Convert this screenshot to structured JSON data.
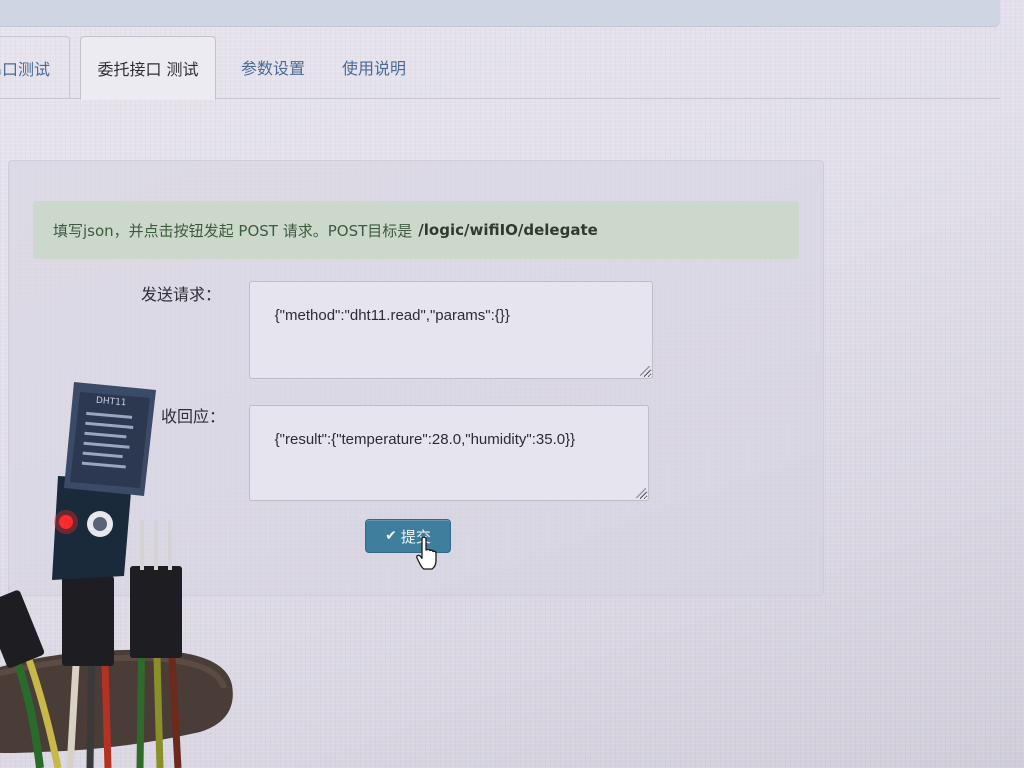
{
  "tabs": [
    {
      "label": "串口测试"
    },
    {
      "label": "委托接口 测试"
    },
    {
      "label": "参数设置"
    },
    {
      "label": "使用说明"
    }
  ],
  "alert": {
    "text": "填写json，并点击按钮发起 POST 请求。POST目标是",
    "target": "/logic/wifiIO/delegate"
  },
  "form": {
    "request_label": "发送请求：",
    "request_value": "{\"method\":\"dht11.read\",\"params\":{}}",
    "response_label": "收回应：",
    "response_value": "{\"result\":{\"temperature\":28.0,\"humidity\":35.0}}",
    "submit_label": "提交"
  },
  "sensor": {
    "model": "DHT11"
  },
  "colors": {
    "submit_bg": "#3f7e9c",
    "alert_bg": "#cdd8cc",
    "tab_link": "#4a6a96",
    "led": "#ff2a2a"
  },
  "icons": {
    "submit": "check-icon",
    "pointer": "hand-cursor-icon"
  }
}
